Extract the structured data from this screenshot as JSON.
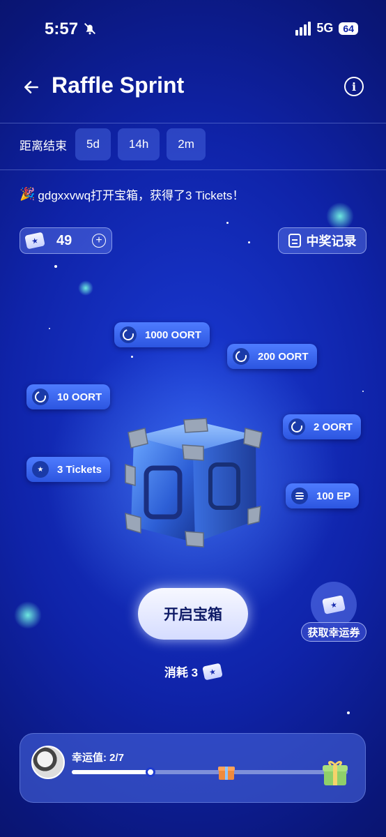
{
  "status_bar": {
    "time": "5:57",
    "network": "5G",
    "battery": "64"
  },
  "header": {
    "title": "Raffle Sprint"
  },
  "countdown": {
    "label": "距离结束",
    "days": "5d",
    "hours": "14h",
    "minutes": "2m"
  },
  "ticker": {
    "message": "gdgxxvwq打开宝箱，获得了3 Tickets！"
  },
  "tickets": {
    "count": "49"
  },
  "records_button": {
    "label": "中奖记录"
  },
  "prizes": [
    {
      "label": "1000 OORT",
      "icon": "oort-coin-icon"
    },
    {
      "label": "200 OORT",
      "icon": "oort-coin-icon"
    },
    {
      "label": "10 OORT",
      "icon": "oort-coin-icon"
    },
    {
      "label": "2 OORT",
      "icon": "oort-coin-icon"
    },
    {
      "label": "3 Tickets",
      "icon": "ticket-icon"
    },
    {
      "label": "100 EP",
      "icon": "ep-stack-icon"
    }
  ],
  "open_button": {
    "label": "开启宝箱"
  },
  "get_tickets": {
    "label": "获取幸运券"
  },
  "cost": {
    "label": "消耗 3"
  },
  "luck": {
    "label": "幸运值: 2/7",
    "progress": 0.286
  },
  "colors": {
    "accent": "#2c55e0",
    "background": "#0f23a8",
    "button": "#f7f8ff"
  }
}
